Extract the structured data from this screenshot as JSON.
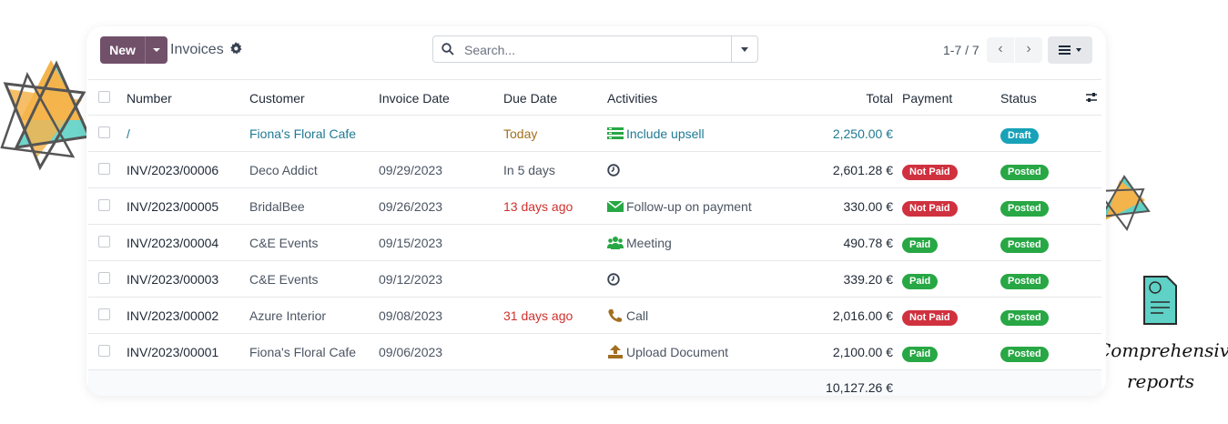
{
  "control_panel": {
    "new_label": "New",
    "title": "Invoices",
    "search_placeholder": "Search...",
    "pager": "1-7 / 7"
  },
  "columns": {
    "number": "Number",
    "customer": "Customer",
    "invoice_date": "Invoice Date",
    "due_date": "Due Date",
    "activities": "Activities",
    "total": "Total",
    "payment": "Payment",
    "status": "Status"
  },
  "rows": [
    {
      "number": "/",
      "customer": "Fiona's Floral Cafe",
      "invoice_date": "",
      "due_date": "Today",
      "activity": "Include upsell",
      "activity_icon": "list-icon",
      "total": "2,250.00 €",
      "payment": "",
      "status": "Draft"
    },
    {
      "number": "INV/2023/00006",
      "customer": "Deco Addict",
      "invoice_date": "09/29/2023",
      "due_date": "In 5 days",
      "activity": "",
      "activity_icon": "clock-icon",
      "total": "2,601.28 €",
      "payment": "Not Paid",
      "status": "Posted"
    },
    {
      "number": "INV/2023/00005",
      "customer": "BridalBee",
      "invoice_date": "09/26/2023",
      "due_date": "13 days ago",
      "activity": "Follow-up on payment",
      "activity_icon": "envelope-icon",
      "total": "330.00 €",
      "payment": "Not Paid",
      "status": "Posted"
    },
    {
      "number": "INV/2023/00004",
      "customer": "C&E Events",
      "invoice_date": "09/15/2023",
      "due_date": "",
      "activity": "Meeting",
      "activity_icon": "users-icon",
      "total": "490.78 €",
      "payment": "Paid",
      "status": "Posted"
    },
    {
      "number": "INV/2023/00003",
      "customer": "C&E Events",
      "invoice_date": "09/12/2023",
      "due_date": "",
      "activity": "",
      "activity_icon": "clock-icon",
      "total": "339.20 €",
      "payment": "Paid",
      "status": "Posted"
    },
    {
      "number": "INV/2023/00002",
      "customer": "Azure Interior",
      "invoice_date": "09/08/2023",
      "due_date": "31 days ago",
      "activity": "Call",
      "activity_icon": "phone-icon",
      "total": "2,016.00 €",
      "payment": "Not Paid",
      "status": "Posted"
    },
    {
      "number": "INV/2023/00001",
      "customer": "Fiona's Floral Cafe",
      "invoice_date": "09/06/2023",
      "due_date": "",
      "activity": "Upload Document",
      "activity_icon": "upload-icon",
      "total": "2,100.00 €",
      "payment": "Paid",
      "status": "Posted"
    }
  ],
  "footer": {
    "total": "10,127.26 €"
  },
  "promo": {
    "line1": "Comprehensive",
    "line2": "reports"
  },
  "colors": {
    "primary": "#71506a",
    "paid": "#28a745",
    "not_paid": "#d0313f",
    "draft": "#17a2b8",
    "link": "#1f7a93",
    "late": "#d0312d",
    "today": "#a26f1f"
  }
}
